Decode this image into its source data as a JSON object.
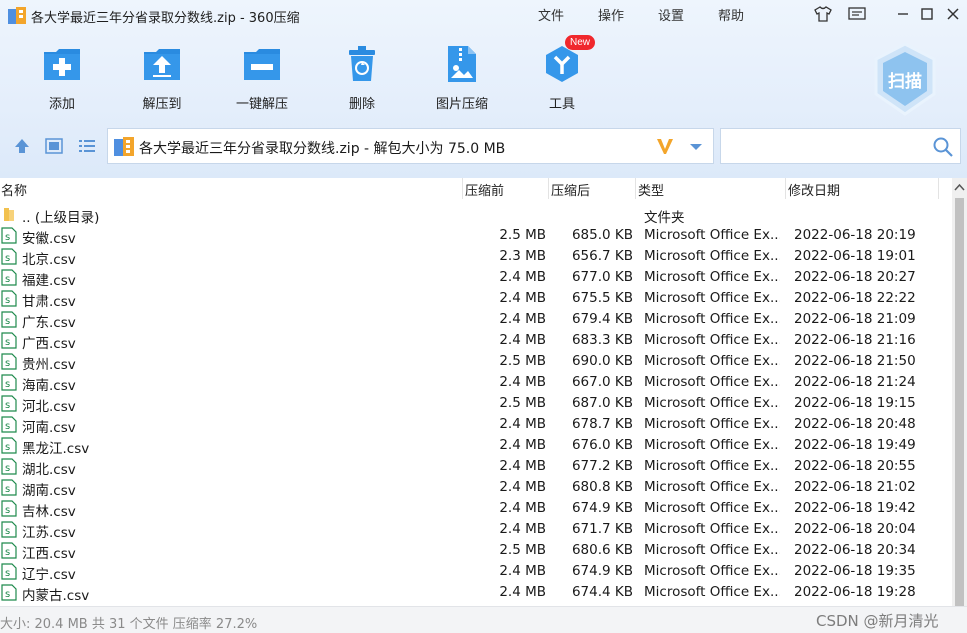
{
  "window": {
    "title": "各大学最近三年分省录取分数线.zip - 360压缩"
  },
  "menu": {
    "file": "文件",
    "operation": "操作",
    "settings": "设置",
    "help": "帮助"
  },
  "toolbar": {
    "add": "添加",
    "extract_to": "解压到",
    "one_click_extract": "一键解压",
    "delete": "删除",
    "image_compress": "图片压缩",
    "tools": "工具",
    "new_badge": "New",
    "scan": "扫描"
  },
  "address": {
    "path": "各大学最近三年分省录取分数线.zip - 解包大小为 75.0 MB"
  },
  "search": {
    "placeholder": ""
  },
  "columns": {
    "name": "名称",
    "size": "压缩前",
    "compressed": "压缩后",
    "type": "类型",
    "modified": "修改日期"
  },
  "files": [
    {
      "name": ".. (上级目录)",
      "size": "",
      "compressed": "",
      "type": "文件夹",
      "modified": "",
      "icon": "folder-icon"
    },
    {
      "name": "安徽.csv",
      "size": "2.5 MB",
      "compressed": "685.0 KB",
      "type": "Microsoft Office Ex...",
      "modified": "2022-06-18 20:19",
      "icon": "csv-file-icon"
    },
    {
      "name": "北京.csv",
      "size": "2.3 MB",
      "compressed": "656.7 KB",
      "type": "Microsoft Office Ex...",
      "modified": "2022-06-18 19:01",
      "icon": "csv-file-icon"
    },
    {
      "name": "福建.csv",
      "size": "2.4 MB",
      "compressed": "677.0 KB",
      "type": "Microsoft Office Ex...",
      "modified": "2022-06-18 20:27",
      "icon": "csv-file-icon"
    },
    {
      "name": "甘肃.csv",
      "size": "2.4 MB",
      "compressed": "675.5 KB",
      "type": "Microsoft Office Ex...",
      "modified": "2022-06-18 22:22",
      "icon": "csv-file-icon"
    },
    {
      "name": "广东.csv",
      "size": "2.4 MB",
      "compressed": "679.4 KB",
      "type": "Microsoft Office Ex...",
      "modified": "2022-06-18 21:09",
      "icon": "csv-file-icon"
    },
    {
      "name": "广西.csv",
      "size": "2.4 MB",
      "compressed": "683.3 KB",
      "type": "Microsoft Office Ex...",
      "modified": "2022-06-18 21:16",
      "icon": "csv-file-icon"
    },
    {
      "name": "贵州.csv",
      "size": "2.5 MB",
      "compressed": "690.0 KB",
      "type": "Microsoft Office Ex...",
      "modified": "2022-06-18 21:50",
      "icon": "csv-file-icon"
    },
    {
      "name": "海南.csv",
      "size": "2.4 MB",
      "compressed": "667.0 KB",
      "type": "Microsoft Office Ex...",
      "modified": "2022-06-18 21:24",
      "icon": "csv-file-icon"
    },
    {
      "name": "河北.csv",
      "size": "2.5 MB",
      "compressed": "687.0 KB",
      "type": "Microsoft Office Ex...",
      "modified": "2022-06-18 19:15",
      "icon": "csv-file-icon"
    },
    {
      "name": "河南.csv",
      "size": "2.4 MB",
      "compressed": "678.7 KB",
      "type": "Microsoft Office Ex...",
      "modified": "2022-06-18 20:48",
      "icon": "csv-file-icon"
    },
    {
      "name": "黑龙江.csv",
      "size": "2.4 MB",
      "compressed": "676.0 KB",
      "type": "Microsoft Office Ex...",
      "modified": "2022-06-18 19:49",
      "icon": "csv-file-icon"
    },
    {
      "name": "湖北.csv",
      "size": "2.4 MB",
      "compressed": "677.2 KB",
      "type": "Microsoft Office Ex...",
      "modified": "2022-06-18 20:55",
      "icon": "csv-file-icon"
    },
    {
      "name": "湖南.csv",
      "size": "2.4 MB",
      "compressed": "680.8 KB",
      "type": "Microsoft Office Ex...",
      "modified": "2022-06-18 21:02",
      "icon": "csv-file-icon"
    },
    {
      "name": "吉林.csv",
      "size": "2.4 MB",
      "compressed": "674.9 KB",
      "type": "Microsoft Office Ex...",
      "modified": "2022-06-18 19:42",
      "icon": "csv-file-icon"
    },
    {
      "name": "江苏.csv",
      "size": "2.4 MB",
      "compressed": "671.7 KB",
      "type": "Microsoft Office Ex...",
      "modified": "2022-06-18 20:04",
      "icon": "csv-file-icon"
    },
    {
      "name": "江西.csv",
      "size": "2.5 MB",
      "compressed": "680.6 KB",
      "type": "Microsoft Office Ex...",
      "modified": "2022-06-18 20:34",
      "icon": "csv-file-icon"
    },
    {
      "name": "辽宁.csv",
      "size": "2.4 MB",
      "compressed": "674.9 KB",
      "type": "Microsoft Office Ex...",
      "modified": "2022-06-18 19:35",
      "icon": "csv-file-icon"
    },
    {
      "name": "内蒙古.csv",
      "size": "2.4 MB",
      "compressed": "674.4 KB",
      "type": "Microsoft Office Ex...",
      "modified": "2022-06-18 19:28",
      "icon": "csv-file-icon"
    }
  ],
  "status": {
    "summary": "大小: 20.4 MB 共 31 个文件 压缩率 27.2%",
    "watermark": "CSDN @新月清光"
  },
  "colors": {
    "accent": "#2a8be0",
    "toolbar_bg": "#e4eefb",
    "csv_icon": "#1f8a4c",
    "folder_icon": "#f2c14e",
    "new_badge": "#f0282d"
  }
}
